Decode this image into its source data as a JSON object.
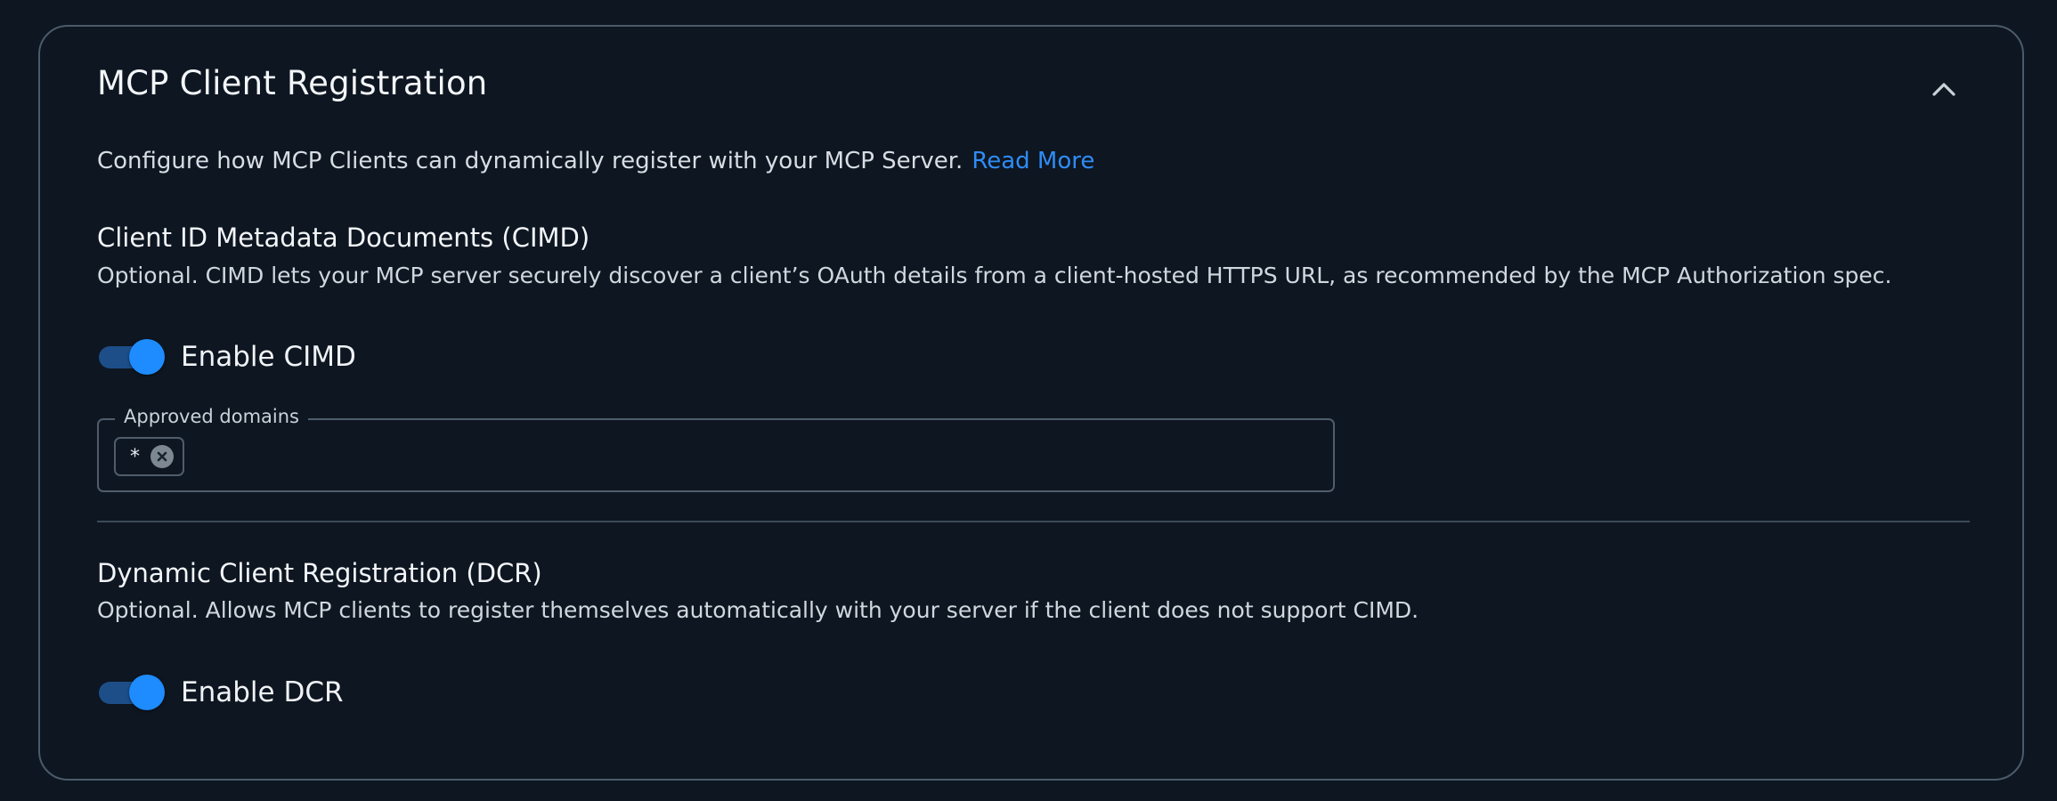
{
  "panel": {
    "title": "MCP Client Registration",
    "collapse_icon": "chevron-up-icon"
  },
  "intro": {
    "text": "Configure how MCP Clients can dynamically register with your MCP Server.",
    "link_label": "Read More"
  },
  "cimd": {
    "title": "Client ID Metadata Documents (CIMD)",
    "description": "Optional. CIMD lets your MCP server securely discover a client’s OAuth details from a client-hosted HTTPS URL, as recommended by the MCP Authorization spec.",
    "toggle_label": "Enable CIMD",
    "enabled": true,
    "approved_domains_label": "Approved domains",
    "approved_domains": [
      "*"
    ]
  },
  "dcr": {
    "title": "Dynamic Client Registration (DCR)",
    "description": "Optional. Allows MCP clients to register themselves automatically with your server if the client does not support CIMD.",
    "toggle_label": "Enable DCR",
    "enabled": true
  },
  "colors": {
    "background": "#0e1621",
    "accent": "#1e8cff",
    "link": "#2f8cf5",
    "border": "#4a5b6a"
  }
}
